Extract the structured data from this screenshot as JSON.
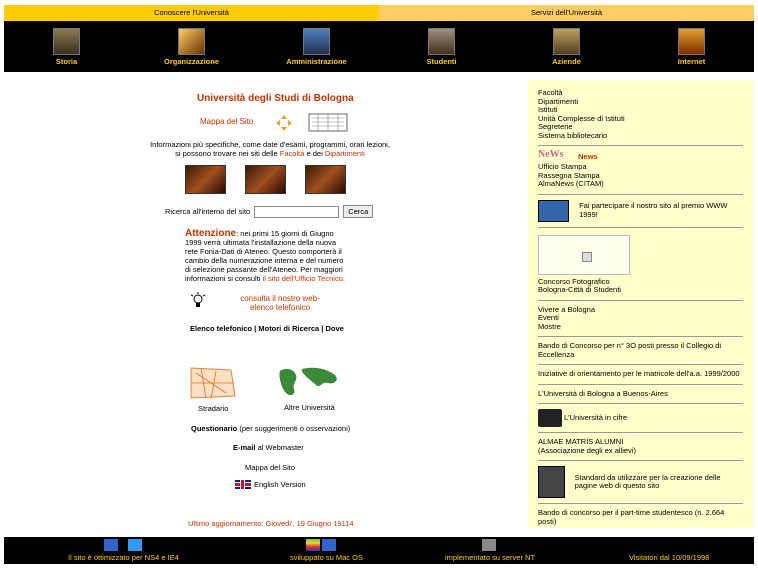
{
  "top_tabs": [
    "Conoscere l'Università",
    "Servizi dell'Università"
  ],
  "nav": [
    {
      "label": "Storia",
      "icon": "history-icon"
    },
    {
      "label": "Organizzazione",
      "icon": "organization-icon"
    },
    {
      "label": "Amministrazione",
      "icon": "administration-icon"
    },
    {
      "label": "Studenti",
      "icon": "students-icon"
    },
    {
      "label": "Aziende",
      "icon": "companies-icon"
    },
    {
      "label": "Internet",
      "icon": "internet-icon"
    }
  ],
  "main": {
    "title": "Università degli Studi di Bologna",
    "site_map": "Mappa del Sito",
    "info_pre": "Informazioni più specifiche, come date d'esami, programmi, orari lezioni, si possono trovare nei siti delle ",
    "info_fac": "Facoltà",
    "info_mid": " e dei ",
    "info_dip": "Dipartimenti",
    "search_label": "Ricerca all'interno del sito",
    "search_value": "",
    "search_button": "Cerca",
    "attention_head": "Attenzione",
    "attention_body": ": nei primi 15 giorni di Giugno 1999 verrà ultimata l'installazione della nuova rete Fonia-Dati di Ateneo. Questo comporterà il cambio della numerazione interna e del numero di selezione passante dell'Ateneo. Per maggiori informazioni si consulti ",
    "attention_link": "il sito dell'Ufficio Tecnico.",
    "consult": "consulta il nostro web-elenco telefonico",
    "links_line": "Elenco telefonico | Motori di Ricerca | Dove",
    "stradario": "Stradario",
    "altre": "Altre Università",
    "questionario": "Questionario",
    "questionario_rest": " (per suggerimenti o osservazioni)",
    "email": "E-mail",
    "email_rest": " al Webmaster",
    "mappa2": "Mappa del Sito",
    "english": "English Version",
    "updated": "Ultimo aggiornamento: Giovedi', 19 Giugno 19114"
  },
  "side": {
    "links1": [
      "Facoltà",
      "Dipartimenti",
      "Istituti",
      "Unità Complesse di Istituti",
      "Segreterie",
      "Sistema bibliotecario"
    ],
    "news_img": "NeWs",
    "news": "News",
    "links2": [
      "Ufficio Stampa",
      "Rassegna Stampa",
      "AlmaNews (CITAM)"
    ],
    "premio": "Fai partecipare il nostro sito al premio WWW 1999!",
    "concorso": [
      "Concorso Fotografico",
      "Bologna-Città di Studenti"
    ],
    "vivere": [
      "Vivere a Bologna",
      "Eventi",
      "Mostre"
    ],
    "bando1": "Bando di Concorso per n° 3O posti presso il Collegio di Eccellenza",
    "iniziative": "Iniziative di orientamento per le matricole dell'a.a. 1999/2000",
    "buenos": "L'Università di Bologna a Buenos-Aires",
    "cifre": "L'Università in cifre",
    "alumni": [
      "ALMAE MATRIS ALUMNI",
      "(Associazione degli ex allievi)"
    ],
    "standard": "Standard da utilizzare per la creazione delle pagine web di questo sito",
    "bando2": "Bando di concorso per il part-time studentesco (n. 2.664 posti)"
  },
  "footer": [
    "Il sito è ottimizzato per NS4 e IE4",
    "sviluppato su Mac OS",
    "implementato su server NT",
    "Visitatori dal 10/09/1998"
  ]
}
